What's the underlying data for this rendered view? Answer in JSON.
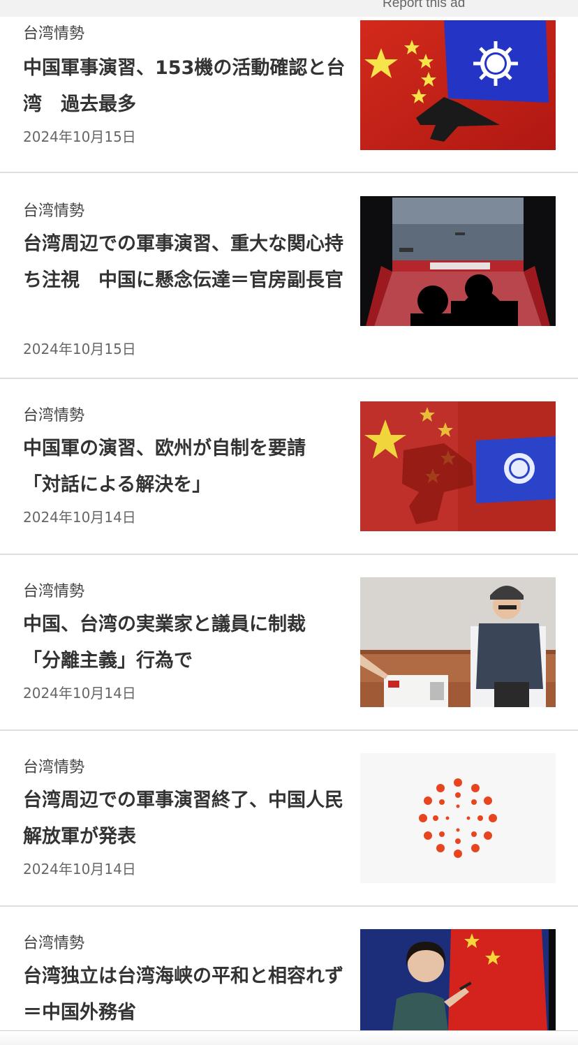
{
  "ad": {
    "label": "Report this ad"
  },
  "articles": [
    {
      "category": "台湾情勢",
      "title": "中国軍事演習、153機の活動確認と台湾　過去最多",
      "date": "2024年10月15日",
      "image": "china-taiwan-flags-jet-photo"
    },
    {
      "category": "台湾情勢",
      "title": "台湾周辺での軍事演習、重大な関心持ち注視　中国に懸念伝達＝官房副長官",
      "date": "2024年10月15日",
      "image": "screen-viewers-photo"
    },
    {
      "category": "台湾情勢",
      "title": "中国軍の演習、欧州が自制を要請　「対話による解決を」",
      "date": "2024年10月14日",
      "image": "flags-jet-silhouette-photo"
    },
    {
      "category": "台湾情勢",
      "title": "中国、台湾の実業家と議員に制裁　「分離主義」行為で",
      "date": "2024年10月14日",
      "image": "man-helmet-vest-photo"
    },
    {
      "category": "台湾情勢",
      "title": "台湾周辺での軍事演習終了、中国人民解放軍が発表",
      "date": "2024年10月14日",
      "image": "reuters-logo-placeholder"
    },
    {
      "category": "台湾情勢",
      "title": "台湾独立は台湾海峡の平和と相容れず＝中国外務省",
      "date": "",
      "image": "spokeswoman-flag-photo"
    }
  ]
}
